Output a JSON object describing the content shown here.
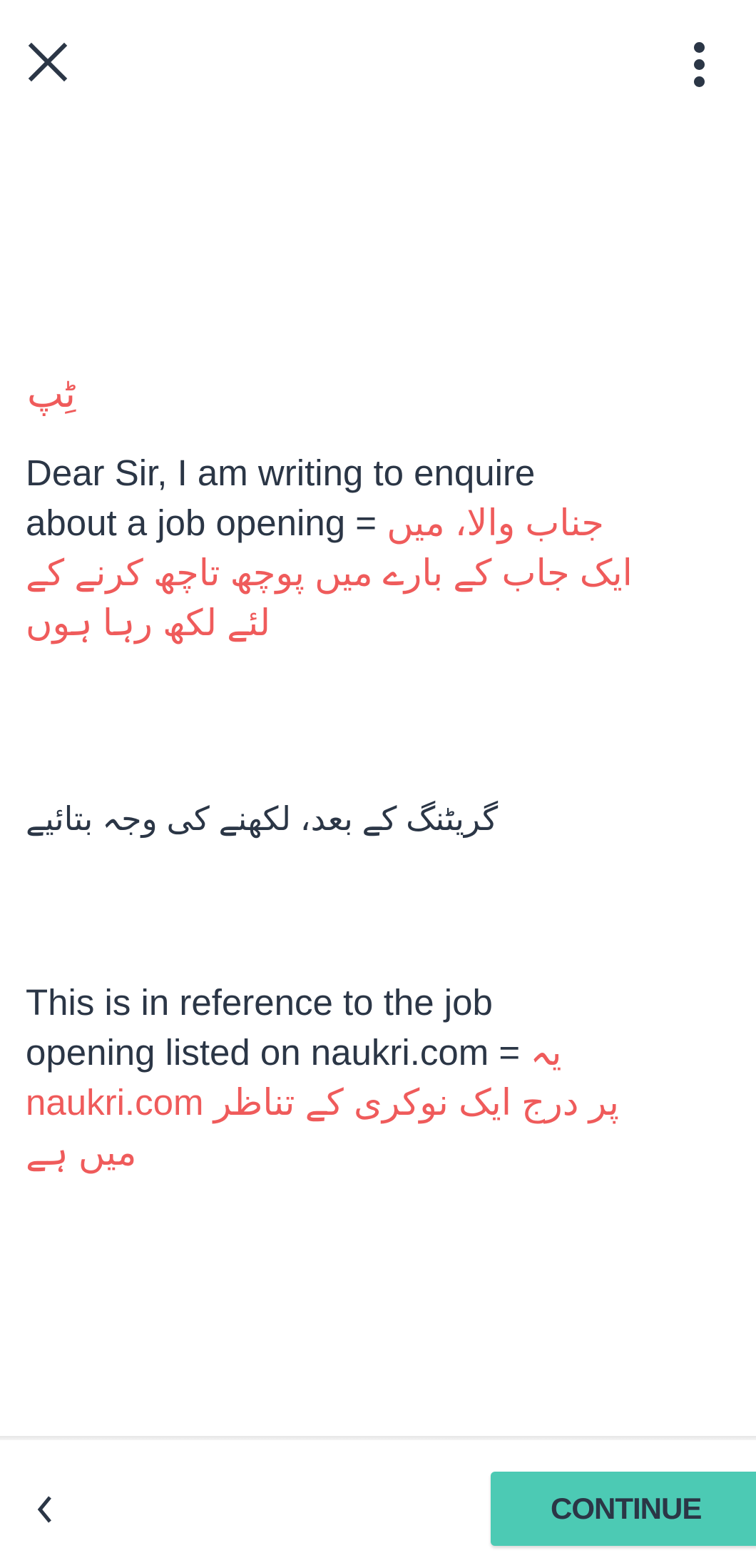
{
  "header": {
    "close_icon": "close-icon",
    "menu_icon": "more-vertical-icon"
  },
  "tip": {
    "title": "ٹِپ",
    "example1": {
      "english_line1": "Dear Sir, I am writing to enquire",
      "english_line2": "about a job opening =",
      "urdu_line1": "جناب والا، میں",
      "urdu_line2": "ایک جاب کے بارے میں پوچھ تاچھ کرنے کے",
      "urdu_line3": "لئے لکھ رہا ہوں"
    },
    "instruction": "گریٹنگ کے بعد، لکھنے کی وجہ بتائیے",
    "example2": {
      "english_line1": "This is in reference to the job",
      "english_line2": "opening listed on naukri.com =",
      "urdu_line1": "یہ",
      "urdu_line2_latin": "naukri.com",
      "urdu_line2": "پر درج ایک نوکری کے تناظر",
      "urdu_line3": "میں ہے"
    }
  },
  "footer": {
    "back_icon": "chevron-left-icon",
    "continue_label": "CONTINUE"
  },
  "colors": {
    "accent": "#4ccab4",
    "urdu_text": "#ef5b5b",
    "text": "#2b3646"
  }
}
